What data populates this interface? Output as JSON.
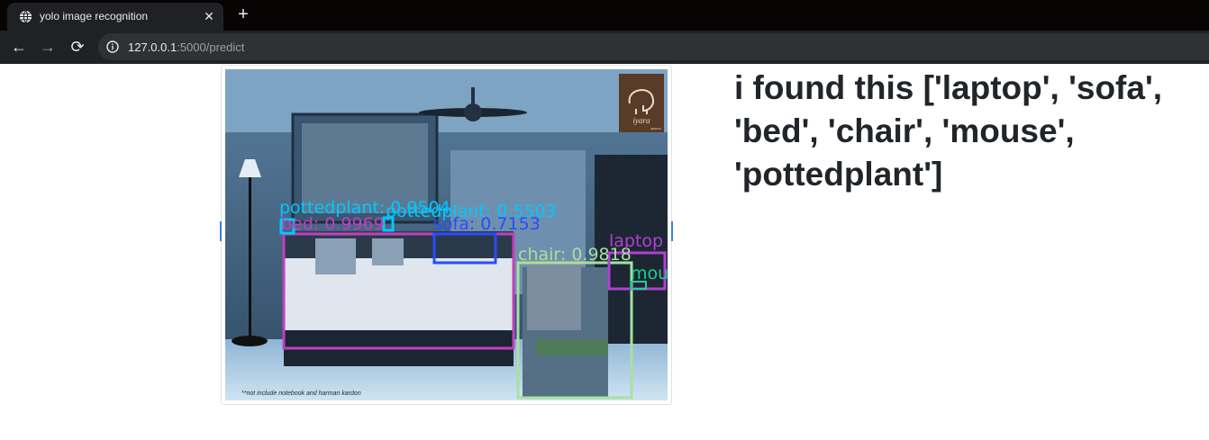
{
  "browser": {
    "tab": {
      "title": "yolo image recognition",
      "favicon": "globe-icon",
      "close_glyph": "✕"
    },
    "new_tab_glyph": "+",
    "nav": {
      "back_glyph": "←",
      "forward_glyph": "→",
      "reload_glyph": "⟳"
    },
    "address": {
      "host": "127.0.0.1",
      "path": ":5000/predict",
      "security_icon": "info-icon"
    }
  },
  "page": {
    "result_text": "i found this ['laptop', 'sofa', 'bed', 'chair', 'mouse', 'pottedplant']"
  },
  "photo": {
    "logo_text": "iyara",
    "logo_subtext": "DESIGN",
    "footnote": "**not include notebook and harman kardon",
    "detections": [
      {
        "label": "pottedplant: 0.9504",
        "color": "#00c8ff"
      },
      {
        "label": "pottedplant: 0.5503",
        "color": "#00c8ff"
      },
      {
        "label": "bed: 0.9969",
        "color": "#c040c0"
      },
      {
        "label": "sofa: 0.7153",
        "color": "#2a4cff"
      },
      {
        "label": "chair: 0.9818",
        "color": "#a8e0a0"
      },
      {
        "label": "laptop",
        "color": "#b040d0"
      },
      {
        "label": "mouse",
        "color": "#20d090"
      }
    ]
  },
  "colors": {
    "tabbar_bg": "#080404",
    "toolbar_bg": "#202124",
    "omnibox_bg": "#303134",
    "text_dark": "#212529"
  }
}
